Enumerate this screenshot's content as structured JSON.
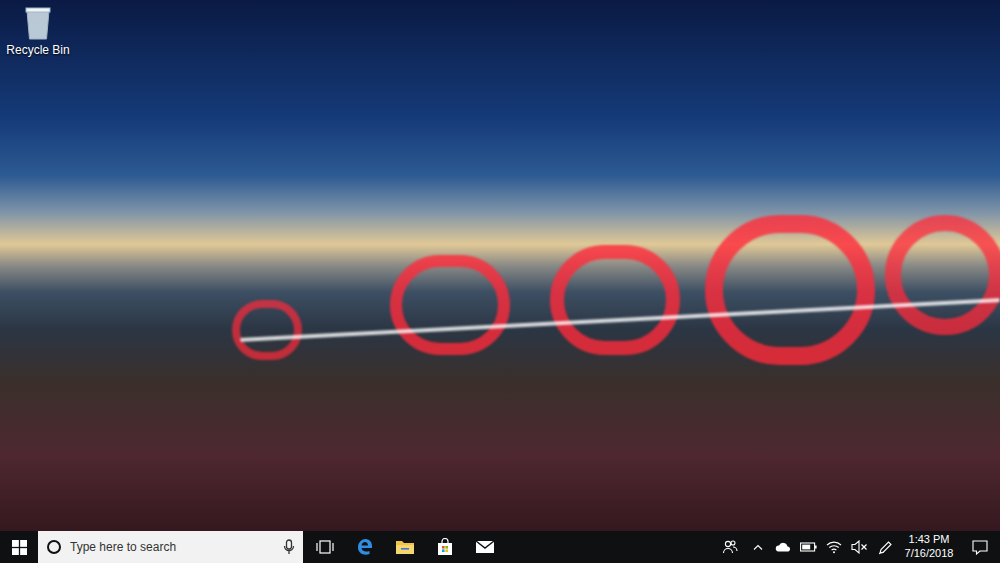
{
  "desktop": {
    "icons": [
      {
        "label": "Recycle Bin",
        "selected": false
      }
    ]
  },
  "taskbar": {
    "search": {
      "placeholder": "Type here to search"
    },
    "tray": {
      "volume": {
        "muted": true
      }
    },
    "clock": {
      "time": "1:43 PM",
      "date": "7/16/2018"
    }
  }
}
